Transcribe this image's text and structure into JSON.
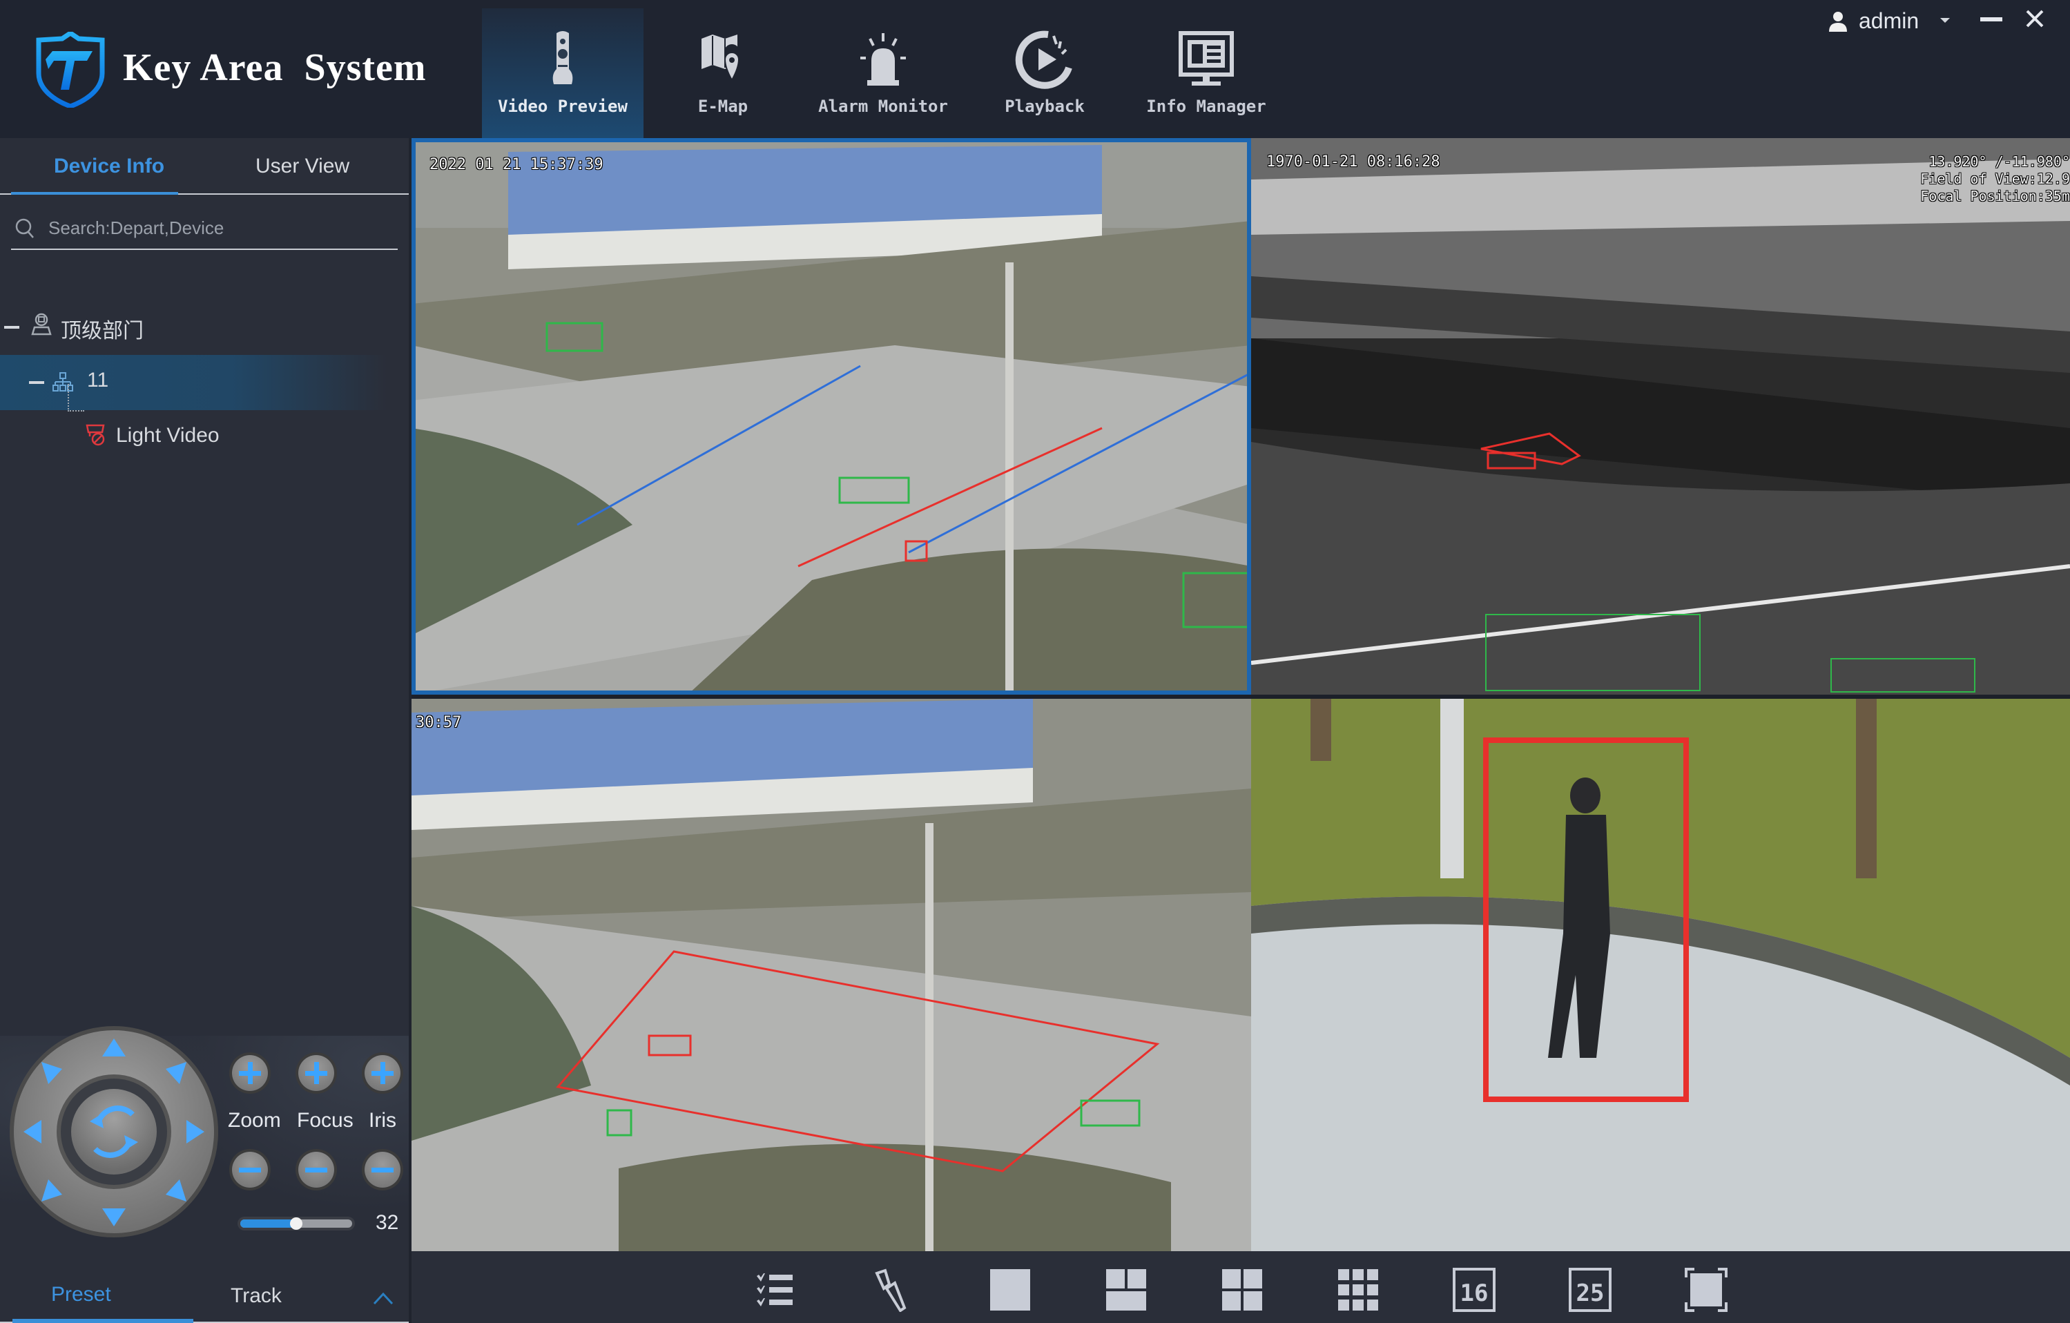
{
  "app": {
    "title": "Key Area  System",
    "nav": [
      {
        "label": "Video Preview",
        "icon": "camera-icon",
        "active": true
      },
      {
        "label": "E-Map",
        "icon": "map-icon",
        "active": false
      },
      {
        "label": "Alarm Monitor",
        "icon": "alarm-icon",
        "active": false
      },
      {
        "label": "Playback",
        "icon": "playback-icon",
        "active": false
      },
      {
        "label": "Info Manager",
        "icon": "monitor-icon",
        "active": false
      }
    ],
    "user": {
      "name": "admin"
    }
  },
  "sidebar": {
    "tabs": [
      {
        "label": "Device Info",
        "active": true
      },
      {
        "label": "User View",
        "active": false
      }
    ],
    "search": {
      "placeholder": "Search:Depart,Device",
      "value": ""
    },
    "tree": [
      {
        "label": "顶级部门",
        "icon": "department-icon",
        "expanded": true,
        "level": 0
      },
      {
        "label": "11",
        "icon": "org-tree-icon",
        "expanded": true,
        "level": 1,
        "selected": true
      },
      {
        "label": "Light Video",
        "icon": "camera-offline-icon",
        "level": 2,
        "status_color": "#e0393e"
      }
    ]
  },
  "ptz": {
    "labels": {
      "zoom": "Zoom",
      "focus": "Focus",
      "iris": "Iris"
    },
    "speed": {
      "value": 32,
      "fraction": 0.5
    },
    "tabs": [
      {
        "label": "Preset",
        "active": true
      },
      {
        "label": "Track",
        "active": false
      }
    ]
  },
  "video": {
    "panes": [
      {
        "id": 1,
        "type": "visible",
        "active": true,
        "osd": "2022 01 21 15:37:39"
      },
      {
        "id": 2,
        "type": "thermal",
        "active": false,
        "osd": "1970-01-21 08:16:28",
        "osd_right": [
          "13.920° /-11.980°",
          "Field of View:12.9",
          "Focal Position:35m"
        ]
      },
      {
        "id": 3,
        "type": "visible",
        "active": false,
        "osd": "30:57"
      },
      {
        "id": 4,
        "type": "zoomed",
        "active": false
      }
    ]
  },
  "toolbar": {
    "buttons": [
      {
        "name": "task-list-icon"
      },
      {
        "name": "clear-icon"
      },
      {
        "name": "layout-1-icon"
      },
      {
        "name": "layout-3-icon"
      },
      {
        "name": "layout-4-icon"
      },
      {
        "name": "layout-9-icon"
      },
      {
        "name": "layout-16-icon",
        "text": "16"
      },
      {
        "name": "layout-25-icon",
        "text": "25"
      },
      {
        "name": "fullscreen-icon"
      }
    ]
  },
  "colors": {
    "accent": "#3a8fd8",
    "header_bg": "#1f2430",
    "sidebar_bg": "#2a2e39",
    "detection_red": "#e8302c",
    "detection_green": "#2fb84a",
    "detection_blue": "#2f6fd8"
  }
}
